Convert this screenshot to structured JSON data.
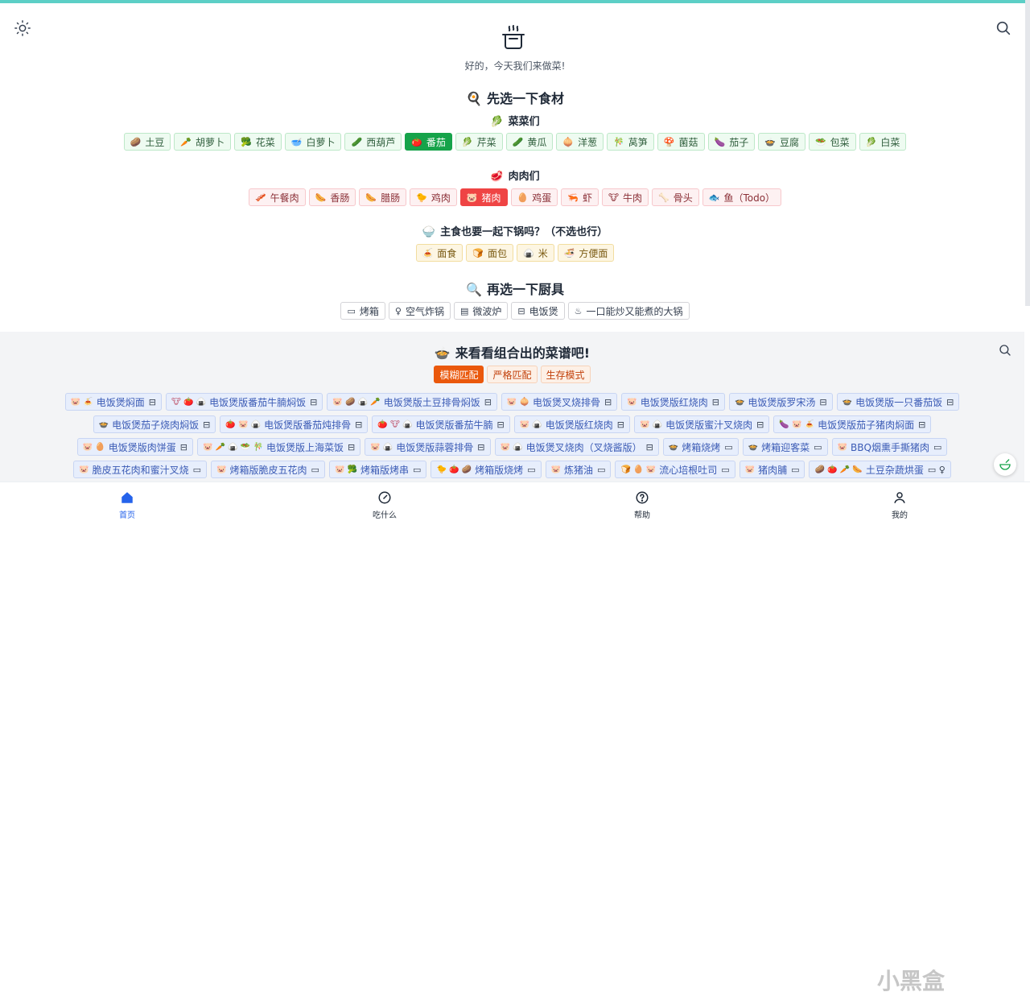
{
  "header": {
    "subtitle": "好的，今天我们来做菜!",
    "logo_icon": "cooking-pot-icon",
    "theme_icon": "sun-icon",
    "search_icon": "search-icon"
  },
  "ingredients": {
    "title": "先选一下食材",
    "title_icon": "🍳",
    "veg_title": "菜菜们",
    "veg_icon": "🥬",
    "vegetables": [
      {
        "label": "土豆",
        "icon": "🥔"
      },
      {
        "label": "胡萝卜",
        "icon": "🥕"
      },
      {
        "label": "花菜",
        "icon": "🥦"
      },
      {
        "label": "白萝卜",
        "icon": "🥣"
      },
      {
        "label": "西葫芦",
        "icon": "🥒"
      },
      {
        "label": "番茄",
        "icon": "🍅",
        "active": true
      },
      {
        "label": "芹菜",
        "icon": "🥬"
      },
      {
        "label": "黄瓜",
        "icon": "🥒"
      },
      {
        "label": "洋葱",
        "icon": "🧅"
      },
      {
        "label": "莴笋",
        "icon": "🎋"
      },
      {
        "label": "菌菇",
        "icon": "🍄"
      },
      {
        "label": "茄子",
        "icon": "🍆"
      },
      {
        "label": "豆腐",
        "icon": "🍲"
      },
      {
        "label": "包菜",
        "icon": "🥗"
      },
      {
        "label": "白菜",
        "icon": "🥬"
      }
    ],
    "meat_title": "肉肉们",
    "meat_icon": "🥩",
    "meats": [
      {
        "label": "午餐肉",
        "icon": "🥓"
      },
      {
        "label": "香肠",
        "icon": "🌭"
      },
      {
        "label": "腊肠",
        "icon": "🌭"
      },
      {
        "label": "鸡肉",
        "icon": "🐤"
      },
      {
        "label": "猪肉",
        "icon": "🐷",
        "active": true
      },
      {
        "label": "鸡蛋",
        "icon": "🥚"
      },
      {
        "label": "虾",
        "icon": "🦐"
      },
      {
        "label": "牛肉",
        "icon": "🐮"
      },
      {
        "label": "骨头",
        "icon": "🦴"
      },
      {
        "label": "鱼（Todo）",
        "icon": "🐟"
      }
    ],
    "staple_title": "主食也要一起下锅吗？（不选也行）",
    "staple_icon": "🍚",
    "staples": [
      {
        "label": "面食",
        "icon": "🍝"
      },
      {
        "label": "面包",
        "icon": "🍞"
      },
      {
        "label": "米",
        "icon": "🍙"
      },
      {
        "label": "方便面",
        "icon": "🍜"
      }
    ]
  },
  "tools": {
    "title": "再选一下厨具",
    "title_icon": "🔍",
    "items": [
      {
        "label": "烤箱",
        "icon": "▭"
      },
      {
        "label": "空气炸锅",
        "icon": "♀"
      },
      {
        "label": "微波炉",
        "icon": "▤"
      },
      {
        "label": "电饭煲",
        "icon": "⊟"
      },
      {
        "label": "一口能炒又能煮的大锅",
        "icon": "♨"
      }
    ]
  },
  "recipes": {
    "title": "来看看组合出的菜谱吧!",
    "title_icon": "🍲",
    "modes": [
      {
        "label": "模糊匹配",
        "active": true
      },
      {
        "label": "严格匹配"
      },
      {
        "label": "生存模式"
      }
    ],
    "rows": [
      [
        {
          "icons": "🐷 🍝",
          "label": "电饭煲焖面",
          "tool": "⊟"
        },
        {
          "icons": "🐮 🍅 🍙",
          "label": "电饭煲版番茄牛腩焖饭",
          "tool": "⊟"
        },
        {
          "icons": "🐷 🥔 🍙 🥕",
          "label": "电饭煲版土豆排骨焖饭",
          "tool": "⊟"
        },
        {
          "icons": "🐷 🧅",
          "label": "电饭煲叉烧排骨",
          "tool": "⊟"
        },
        {
          "icons": "🐷",
          "label": "电饭煲版红烧肉",
          "tool": "⊟"
        },
        {
          "icons": "🍲",
          "label": "电饭煲版罗宋汤",
          "tool": "⊟"
        },
        {
          "icons": "🍲",
          "label": "电饭煲版一只番茄饭",
          "tool": "⊟"
        }
      ],
      [
        {
          "icons": "🍲",
          "label": "电饭煲茄子烧肉焖饭",
          "tool": "⊟"
        },
        {
          "icons": "🍅 🐷 🍙",
          "label": "电饭煲版番茄炖排骨",
          "tool": "⊟"
        },
        {
          "icons": "🍅 🐮 🍙",
          "label": "电饭煲版番茄牛腩",
          "tool": "⊟"
        },
        {
          "icons": "🐷 🍙",
          "label": "电饭煲版红烧肉",
          "tool": "⊟"
        },
        {
          "icons": "🐷 🍙",
          "label": "电饭煲版蜜汁叉烧肉",
          "tool": "⊟"
        },
        {
          "icons": "🍆 🐷 🍝",
          "label": "电饭煲版茄子猪肉焖面",
          "tool": "⊟"
        }
      ],
      [
        {
          "icons": "🐷 🥚",
          "label": "电饭煲版肉饼蛋",
          "tool": "⊟"
        },
        {
          "icons": "🐷 🥕 🍙 🥗 🎋",
          "label": "电饭煲版上海菜饭",
          "tool": "⊟"
        },
        {
          "icons": "🐷 🍙",
          "label": "电饭煲版蒜蓉排骨",
          "tool": "⊟"
        },
        {
          "icons": "🐷 🍙",
          "label": "电饭煲叉烧肉（叉烧酱版）",
          "tool": "⊟"
        },
        {
          "icons": "🍲",
          "label": "烤箱烧烤",
          "tool": "▭"
        },
        {
          "icons": "🍲",
          "label": "烤箱迎客菜",
          "tool": "▭"
        },
        {
          "icons": "🐷",
          "label": "BBQ烟熏手撕猪肉",
          "tool": "▭"
        }
      ],
      [
        {
          "icons": "🐷",
          "label": "脆皮五花肉和蜜汁叉烧",
          "tool": "▭"
        },
        {
          "icons": "🐷",
          "label": "烤箱版脆皮五花肉",
          "tool": "▭"
        },
        {
          "icons": "🐷 🥦",
          "label": "烤箱版烤串",
          "tool": "▭"
        },
        {
          "icons": "🐤 🍅 🥔",
          "label": "烤箱版烧烤",
          "tool": "▭"
        },
        {
          "icons": "🐷",
          "label": "炼猪油",
          "tool": "▭"
        },
        {
          "icons": "🍞 🥚 🐷",
          "label": "流心培根吐司",
          "tool": "▭"
        },
        {
          "icons": "🐷",
          "label": "猪肉脯",
          "tool": "▭"
        },
        {
          "icons": "🥔 🍅 🥕 🌭",
          "label": "土豆杂蔬烘蛋",
          "tool": "▭ ♀"
        }
      ]
    ]
  },
  "nav": {
    "items": [
      {
        "label": "首页",
        "icon": "home-icon",
        "active": true
      },
      {
        "label": "吃什么",
        "icon": "compass-icon"
      },
      {
        "label": "帮助",
        "icon": "help-icon"
      },
      {
        "label": "我的",
        "icon": "user-icon"
      }
    ]
  },
  "watermark": "小黑盒"
}
